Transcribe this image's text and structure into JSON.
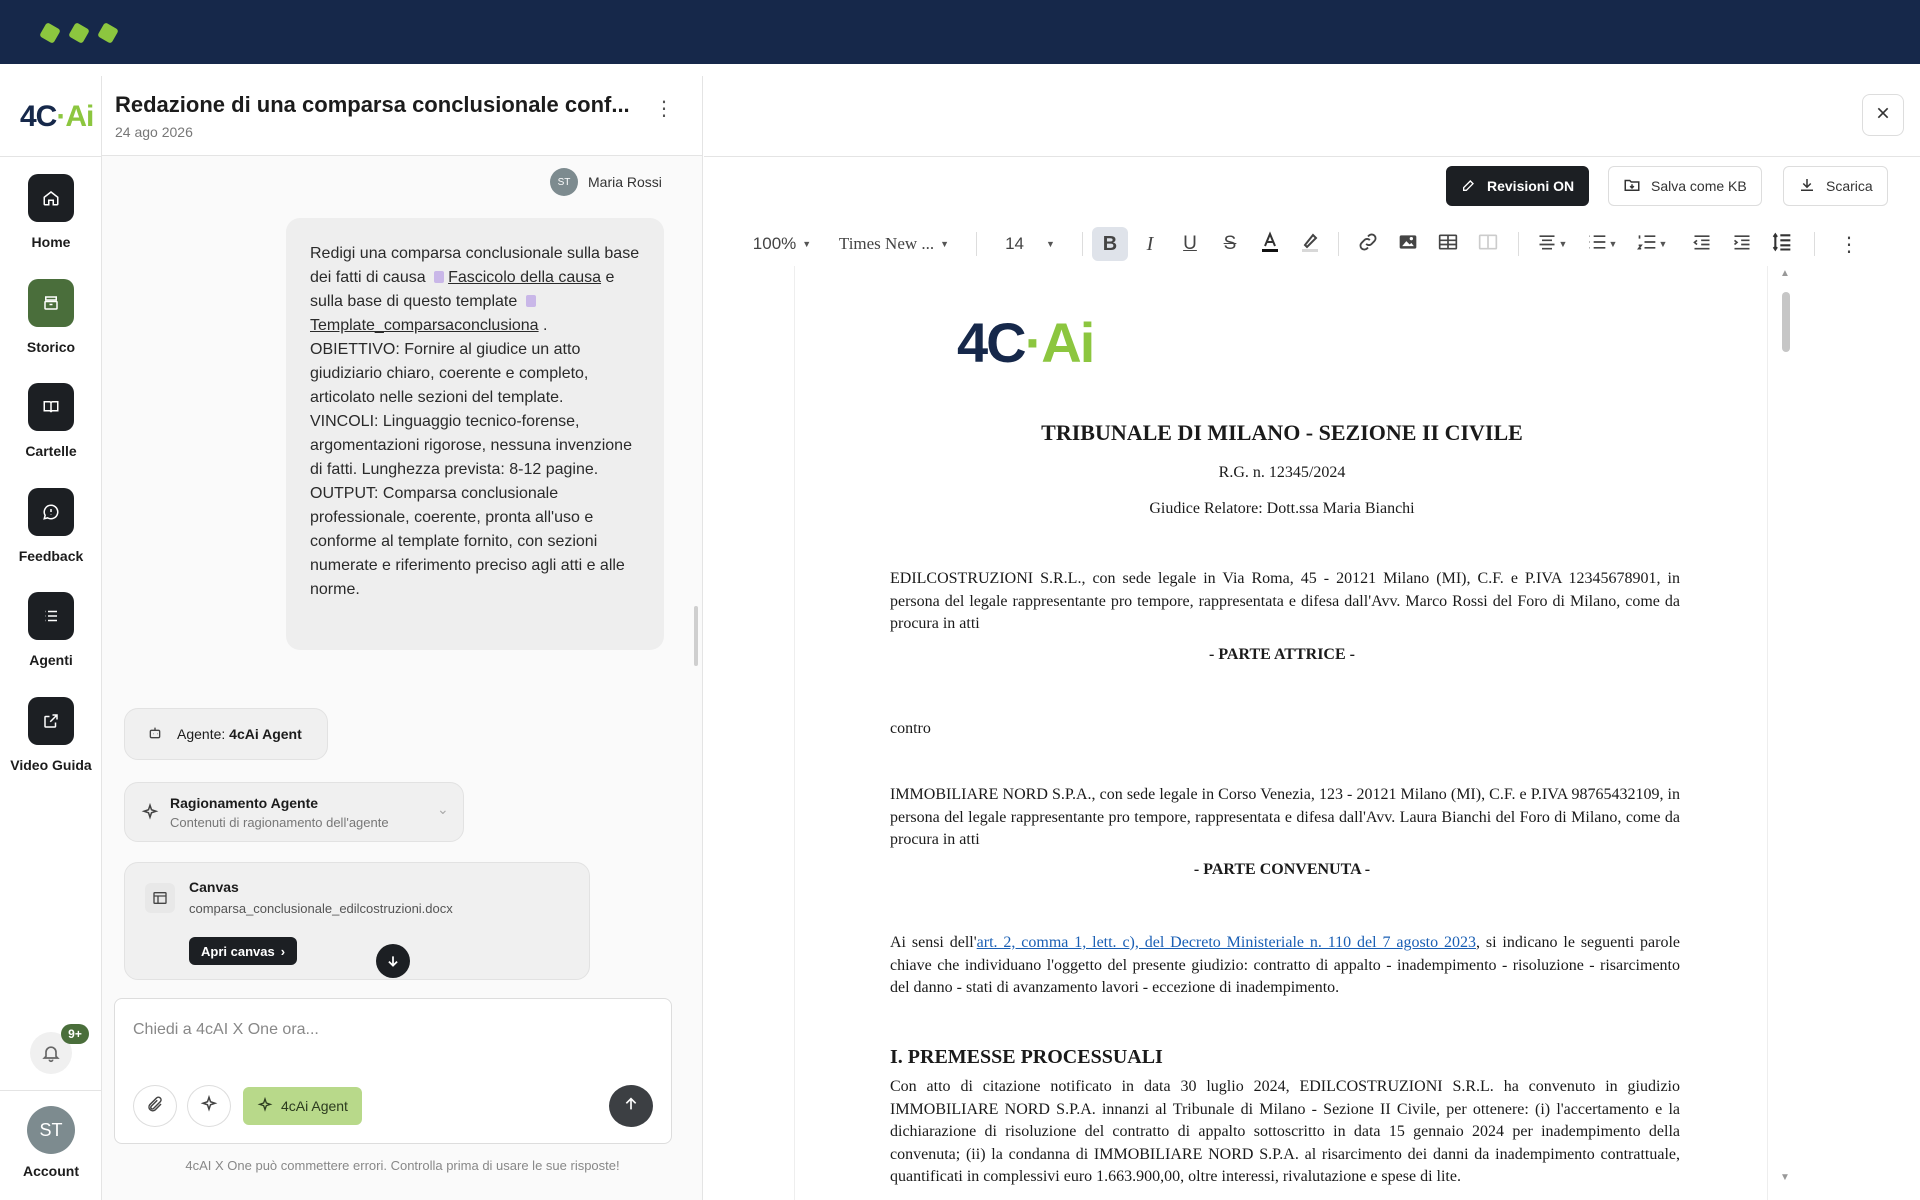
{
  "window": {
    "dots": 3
  },
  "rail": {
    "logo_a": "4C",
    "logo_sep": "·",
    "logo_b": "Ai",
    "items": [
      {
        "label": "Home",
        "icon": "home-icon"
      },
      {
        "label": "Storico",
        "icon": "archive-icon"
      },
      {
        "label": "Cartelle",
        "icon": "book-icon"
      },
      {
        "label": "Feedback",
        "icon": "chat-icon"
      },
      {
        "label": "Agenti",
        "icon": "list-icon"
      },
      {
        "label": "Video Guida",
        "icon": "external-link-icon"
      }
    ],
    "notif_count": "9+",
    "account_initials": "ST",
    "account_label": "Account"
  },
  "chat": {
    "title": "Redazione di una comparsa conclusionale conf...",
    "date": "24 ago 2026",
    "user_initials": "ST",
    "user_name": "Maria Rossi",
    "msg_p1": "Redigi una comparsa conclusionale sulla base dei fatti di causa",
    "msg_link1": "Fascicolo della causa",
    "msg_p2": "e sulla base di questo template",
    "msg_link2": "Template_comparsaconclusiona",
    "msg_p3": ".",
    "msg_obj": "OBIETTIVO: Fornire al giudice un atto giudiziario chiaro, coerente e completo, articolato nelle sezioni del template.",
    "msg_vinc": "VINCOLI: Linguaggio tecnico-forense, argomentazioni rigorose, nessuna invenzione di fatti. Lunghezza prevista: 8-12 pagine.",
    "msg_out": "OUTPUT: Comparsa conclusionale professionale, coerente, pronta all'uso e conforme al template fornito, con sezioni numerate e riferimento preciso agli atti e alle norme.",
    "agent_prefix": "Agente:",
    "agent_name": "4cAi Agent",
    "reason_title": "Ragionamento Agente",
    "reason_sub": "Contenuti di ragionamento dell'agente",
    "canvas_title": "Canvas",
    "canvas_file": "comparsa_conclusionale_edilcostruzioni.docx",
    "open_canvas": "Apri canvas",
    "input_placeholder": "Chiedi a 4cAI X One ora...",
    "agent_chip": "4cAi Agent",
    "disclaimer": "4cAI X One può commettere errori. Controlla prima di usare le sue risposte!"
  },
  "doc": {
    "btn_revisions": "Revisioni ON",
    "btn_save_kb": "Salva come KB",
    "btn_download": "Scarica",
    "zoom": "100%",
    "font_family": "Times New ...",
    "font_size": "14",
    "logo_a": "4C",
    "logo_sep": "·",
    "logo_b": "Ai",
    "court": "TRIBUNALE DI MILANO - SEZIONE II CIVILE",
    "rg": "R.G. n. 12345/2024",
    "judge": "Giudice Relatore: Dott.ssa Maria Bianchi",
    "party1": "EDILCOSTRUZIONI S.R.L., con sede legale in Via Roma, 45 - 20121 Milano (MI), C.F. e P.IVA 12345678901, in persona del legale rappresentante pro tempore, rappresentata e difesa dall'Avv. Marco Rossi del Foro di Milano, come da procura in atti",
    "party1_role": "- PARTE ATTRICE -",
    "versus": "contro",
    "party2": "IMMOBILIARE NORD S.P.A., con sede legale in Corso Venezia, 123 - 20121 Milano (MI), C.F. e P.IVA 98765432109, in persona del legale rappresentante pro tempore, rappresentata e difesa dall'Avv. Laura Bianchi del Foro di Milano, come da procura in atti",
    "party2_role": "- PARTE CONVENUTA -",
    "kw_pre": "Ai sensi dell'",
    "kw_link": "art. 2, comma 1, lett. c), del Decreto Ministeriale n. 110 del 7 agosto 2023",
    "kw_post": ", si indicano le seguenti parole chiave che individuano l'oggetto del presente giudizio: contratto di appalto - inadempimento - risoluzione - risarcimento del danno - stati di avanzamento lavori - eccezione di inadempimento.",
    "section1": "I. PREMESSE PROCESSUALI",
    "section1_text": "Con atto di citazione notificato in data 30 luglio 2024, EDILCOSTRUZIONI S.R.L. ha convenuto in giudizio IMMOBILIARE NORD S.P.A. innanzi al Tribunale di Milano - Sezione II Civile, per ottenere: (i) l'accertamento e la dichiarazione di risoluzione del contratto di appalto sottoscritto in data 15 gennaio 2024 per inadempimento della convenuta; (ii) la condanna di IMMOBILIARE NORD S.P.A. al risarcimento dei danni da inadempimento contrattuale, quantificati in complessivi euro 1.663.900,00, oltre interessi, rivalutazione e spese di lite."
  }
}
